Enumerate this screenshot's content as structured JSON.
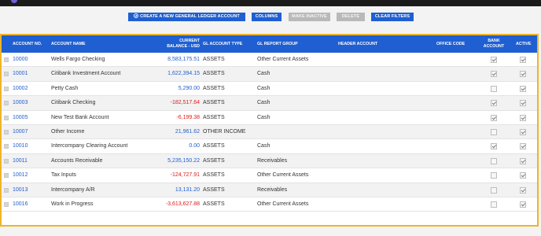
{
  "toolbar": {
    "new_account": "CREATE A NEW GENERAL LEDGER ACCOUNT",
    "columns": "COLUMNS",
    "make_inactive": "MAKE INACTIVE",
    "delete": "DELETE",
    "clear_filters": "CLEAR FILTERS"
  },
  "columns": {
    "account_no": "ACCOUNT NO.",
    "account_name": "ACCOUNT NAME",
    "balance_line1": "CURRENT",
    "balance_line2": "BALANCE - USD",
    "gl_type": "GL ACCOUNT TYPE",
    "report_group": "GL REPORT GROUP",
    "header_account": "HEADER ACCOUNT",
    "office_code": "OFFICE CODE",
    "bank_line1": "BANK",
    "bank_line2": "ACCOUNT",
    "active": "ACTIVE"
  },
  "rows": [
    {
      "no": "10000",
      "name": "Wells Fargo Checking",
      "balance": "8,583,175.51",
      "type": "ASSETS",
      "group": "Other Current Assets",
      "bank": true,
      "active": true
    },
    {
      "no": "10001",
      "name": "Citibank Investment Account",
      "balance": "1,622,394.15",
      "type": "ASSETS",
      "group": "Cash",
      "bank": true,
      "active": true
    },
    {
      "no": "10002",
      "name": "Petty Cash",
      "balance": "5,290.00",
      "type": "ASSETS",
      "group": "Cash",
      "bank": false,
      "active": true
    },
    {
      "no": "10003",
      "name": "Citibank Checking",
      "balance": "-182,517.64",
      "type": "ASSETS",
      "group": "Cash",
      "bank": true,
      "active": true
    },
    {
      "no": "10005",
      "name": "New Test Bank Account",
      "balance": "-6,199.38",
      "type": "ASSETS",
      "group": "Cash",
      "bank": true,
      "active": true
    },
    {
      "no": "10007",
      "name": "Other Income",
      "balance": "21,961.62",
      "type": "OTHER INCOME",
      "group": "",
      "bank": false,
      "active": true
    },
    {
      "no": "10010",
      "name": "Intercompany Clearing Account",
      "balance": "0.00",
      "type": "ASSETS",
      "group": "Cash",
      "bank": true,
      "active": true
    },
    {
      "no": "10011",
      "name": "Accounts Receivable",
      "balance": "5,235,150.22",
      "type": "ASSETS",
      "group": "Receivables",
      "bank": false,
      "active": true
    },
    {
      "no": "10012",
      "name": "Tax Inputs",
      "balance": "-124,727.91",
      "type": "ASSETS",
      "group": "Other Current Assets",
      "bank": false,
      "active": true
    },
    {
      "no": "10013",
      "name": "Intercompany A/R",
      "balance": "13,131.20",
      "type": "ASSETS",
      "group": "Receivables",
      "bank": false,
      "active": true
    },
    {
      "no": "10016",
      "name": "Work in Progress",
      "balance": "-3,613,627.88",
      "type": "ASSETS",
      "group": "Other Current Assets",
      "bank": false,
      "active": true
    }
  ],
  "colors": {
    "accent": "#1f5fd1",
    "negative": "#e01b1b",
    "highlight_border": "#f0b429"
  }
}
